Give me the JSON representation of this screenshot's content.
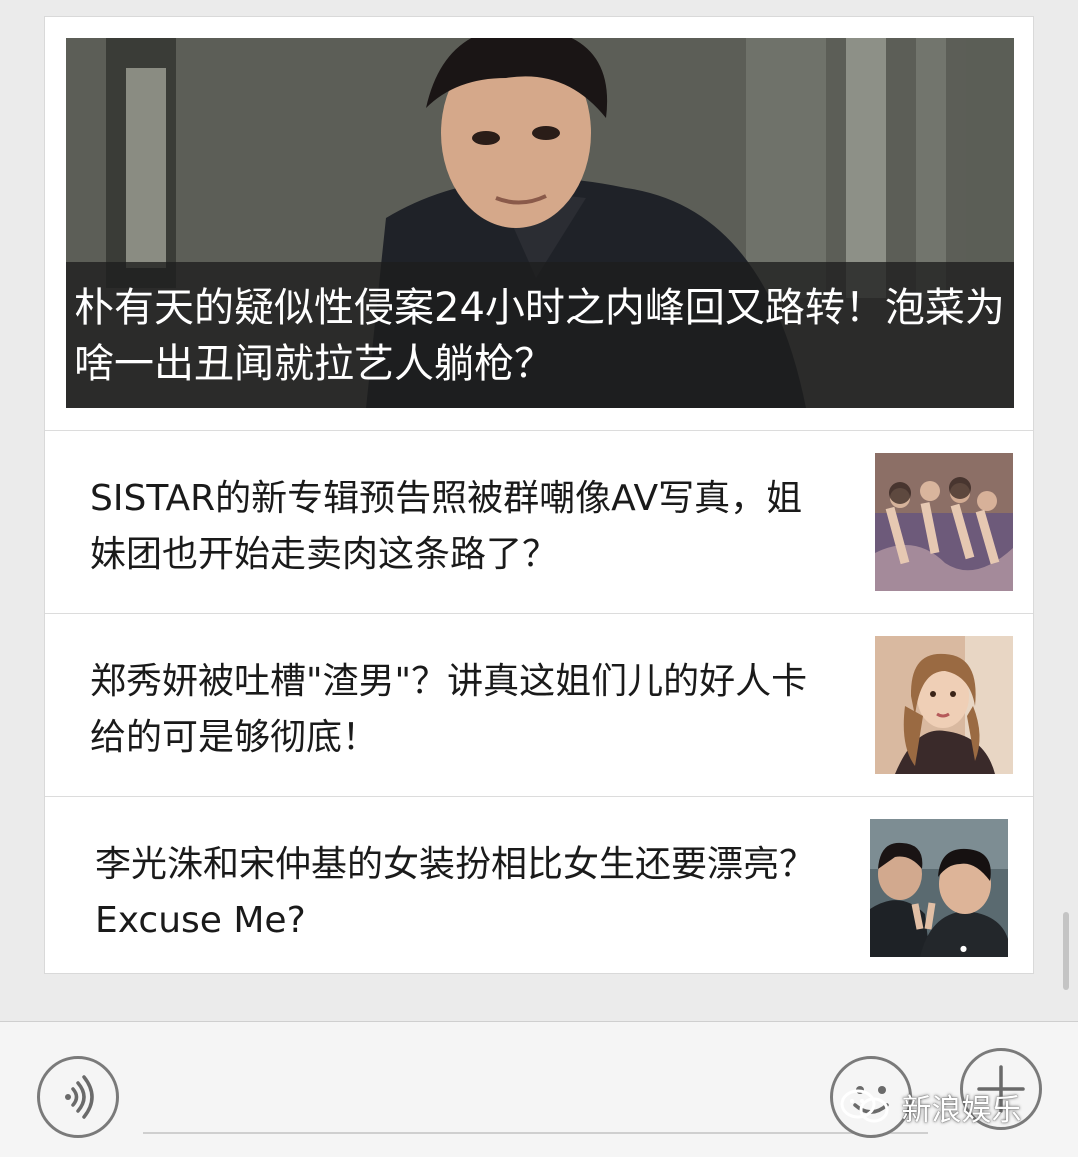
{
  "articles": {
    "hero": {
      "title": "朴有天的疑似性侵案24小时之内峰回又路转！泡菜为啥一出丑闻就拉艺人躺枪？",
      "image": "man-portrait-photo"
    },
    "items": [
      {
        "title": "SISTAR的新专辑预告照被群嘲像AV写真，姐妹团也开始走卖肉这条路了？",
        "image": "group-photo-thumbnail"
      },
      {
        "title": "郑秀妍被吐槽\"渣男\"？讲真这姐们儿的好人卡给的可是够彻底！",
        "image": "woman-portrait-thumbnail"
      },
      {
        "title": "李光洙和宋仲基的女装扮相比女生还要漂亮？Excuse Me?",
        "image": "selfie-thumbnail"
      }
    ]
  },
  "bottom_bar": {
    "voice_icon": "voice-icon",
    "emoji_icon": "emoji-icon",
    "plus_icon": "plus-icon"
  },
  "watermark": {
    "text": "新浪娱乐",
    "icon": "wechat-icon"
  },
  "colors": {
    "background": "#ebebeb",
    "card": "#ffffff",
    "caption_overlay": "#1e1e1e"
  }
}
